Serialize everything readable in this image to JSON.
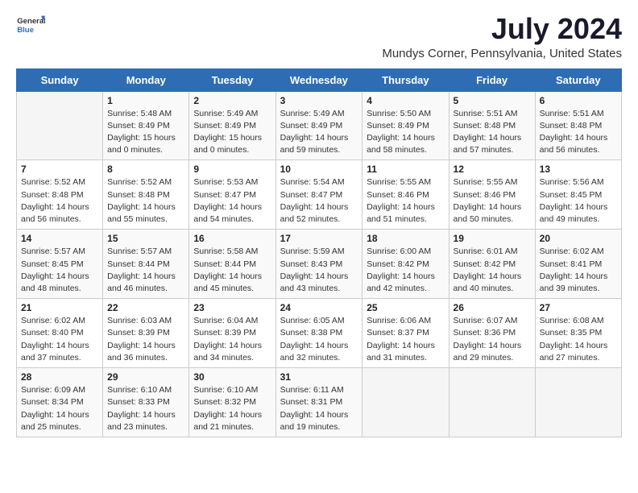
{
  "logo": {
    "general": "General",
    "blue": "Blue"
  },
  "title": "July 2024",
  "subtitle": "Mundys Corner, Pennsylvania, United States",
  "days_of_week": [
    "Sunday",
    "Monday",
    "Tuesday",
    "Wednesday",
    "Thursday",
    "Friday",
    "Saturday"
  ],
  "weeks": [
    [
      {
        "day": "",
        "info": ""
      },
      {
        "day": "1",
        "info": "Sunrise: 5:48 AM\nSunset: 8:49 PM\nDaylight: 15 hours\nand 0 minutes."
      },
      {
        "day": "2",
        "info": "Sunrise: 5:49 AM\nSunset: 8:49 PM\nDaylight: 15 hours\nand 0 minutes."
      },
      {
        "day": "3",
        "info": "Sunrise: 5:49 AM\nSunset: 8:49 PM\nDaylight: 14 hours\nand 59 minutes."
      },
      {
        "day": "4",
        "info": "Sunrise: 5:50 AM\nSunset: 8:49 PM\nDaylight: 14 hours\nand 58 minutes."
      },
      {
        "day": "5",
        "info": "Sunrise: 5:51 AM\nSunset: 8:48 PM\nDaylight: 14 hours\nand 57 minutes."
      },
      {
        "day": "6",
        "info": "Sunrise: 5:51 AM\nSunset: 8:48 PM\nDaylight: 14 hours\nand 56 minutes."
      }
    ],
    [
      {
        "day": "7",
        "info": "Sunrise: 5:52 AM\nSunset: 8:48 PM\nDaylight: 14 hours\nand 56 minutes."
      },
      {
        "day": "8",
        "info": "Sunrise: 5:52 AM\nSunset: 8:48 PM\nDaylight: 14 hours\nand 55 minutes."
      },
      {
        "day": "9",
        "info": "Sunrise: 5:53 AM\nSunset: 8:47 PM\nDaylight: 14 hours\nand 54 minutes."
      },
      {
        "day": "10",
        "info": "Sunrise: 5:54 AM\nSunset: 8:47 PM\nDaylight: 14 hours\nand 52 minutes."
      },
      {
        "day": "11",
        "info": "Sunrise: 5:55 AM\nSunset: 8:46 PM\nDaylight: 14 hours\nand 51 minutes."
      },
      {
        "day": "12",
        "info": "Sunrise: 5:55 AM\nSunset: 8:46 PM\nDaylight: 14 hours\nand 50 minutes."
      },
      {
        "day": "13",
        "info": "Sunrise: 5:56 AM\nSunset: 8:45 PM\nDaylight: 14 hours\nand 49 minutes."
      }
    ],
    [
      {
        "day": "14",
        "info": "Sunrise: 5:57 AM\nSunset: 8:45 PM\nDaylight: 14 hours\nand 48 minutes."
      },
      {
        "day": "15",
        "info": "Sunrise: 5:57 AM\nSunset: 8:44 PM\nDaylight: 14 hours\nand 46 minutes."
      },
      {
        "day": "16",
        "info": "Sunrise: 5:58 AM\nSunset: 8:44 PM\nDaylight: 14 hours\nand 45 minutes."
      },
      {
        "day": "17",
        "info": "Sunrise: 5:59 AM\nSunset: 8:43 PM\nDaylight: 14 hours\nand 43 minutes."
      },
      {
        "day": "18",
        "info": "Sunrise: 6:00 AM\nSunset: 8:42 PM\nDaylight: 14 hours\nand 42 minutes."
      },
      {
        "day": "19",
        "info": "Sunrise: 6:01 AM\nSunset: 8:42 PM\nDaylight: 14 hours\nand 40 minutes."
      },
      {
        "day": "20",
        "info": "Sunrise: 6:02 AM\nSunset: 8:41 PM\nDaylight: 14 hours\nand 39 minutes."
      }
    ],
    [
      {
        "day": "21",
        "info": "Sunrise: 6:02 AM\nSunset: 8:40 PM\nDaylight: 14 hours\nand 37 minutes."
      },
      {
        "day": "22",
        "info": "Sunrise: 6:03 AM\nSunset: 8:39 PM\nDaylight: 14 hours\nand 36 minutes."
      },
      {
        "day": "23",
        "info": "Sunrise: 6:04 AM\nSunset: 8:39 PM\nDaylight: 14 hours\nand 34 minutes."
      },
      {
        "day": "24",
        "info": "Sunrise: 6:05 AM\nSunset: 8:38 PM\nDaylight: 14 hours\nand 32 minutes."
      },
      {
        "day": "25",
        "info": "Sunrise: 6:06 AM\nSunset: 8:37 PM\nDaylight: 14 hours\nand 31 minutes."
      },
      {
        "day": "26",
        "info": "Sunrise: 6:07 AM\nSunset: 8:36 PM\nDaylight: 14 hours\nand 29 minutes."
      },
      {
        "day": "27",
        "info": "Sunrise: 6:08 AM\nSunset: 8:35 PM\nDaylight: 14 hours\nand 27 minutes."
      }
    ],
    [
      {
        "day": "28",
        "info": "Sunrise: 6:09 AM\nSunset: 8:34 PM\nDaylight: 14 hours\nand 25 minutes."
      },
      {
        "day": "29",
        "info": "Sunrise: 6:10 AM\nSunset: 8:33 PM\nDaylight: 14 hours\nand 23 minutes."
      },
      {
        "day": "30",
        "info": "Sunrise: 6:10 AM\nSunset: 8:32 PM\nDaylight: 14 hours\nand 21 minutes."
      },
      {
        "day": "31",
        "info": "Sunrise: 6:11 AM\nSunset: 8:31 PM\nDaylight: 14 hours\nand 19 minutes."
      },
      {
        "day": "",
        "info": ""
      },
      {
        "day": "",
        "info": ""
      },
      {
        "day": "",
        "info": ""
      }
    ]
  ]
}
